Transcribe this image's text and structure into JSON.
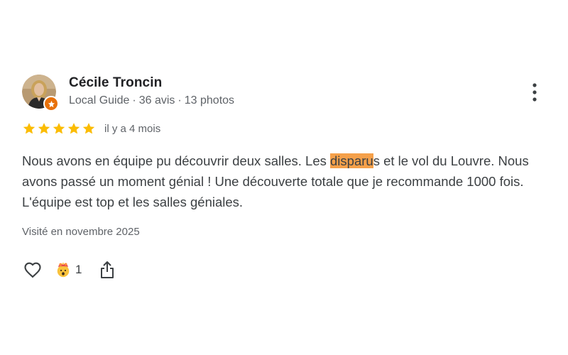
{
  "review": {
    "author": {
      "name": "Cécile Troncin",
      "badge": "Local Guide",
      "separator": "·",
      "reviews_count": "36 avis",
      "photos_count": "13 photos",
      "badge_color": "#e8710a"
    },
    "rating": {
      "stars": 5,
      "max": 5,
      "star_color": "#fbbc04",
      "date": "il y a 4 mois"
    },
    "text": {
      "before": "Nous avons en équipe pu découvrir deux salles. Les ",
      "highlight": "disparu",
      "after": "s et le vol du Louvre. Nous avons passé un moment génial ! Une découverte totale que je recommande 1000 fois. L'équipe est top et les salles géniales.",
      "highlight_color": "#f5a04a"
    },
    "visit_date": "Visité en novembre 2025",
    "actions": {
      "like_icon": "heart-outline-icon",
      "reaction_icon": "exploding-head-emoji",
      "reaction_count": "1",
      "share_icon": "share-icon",
      "more_icon": "more-vert-icon"
    }
  }
}
